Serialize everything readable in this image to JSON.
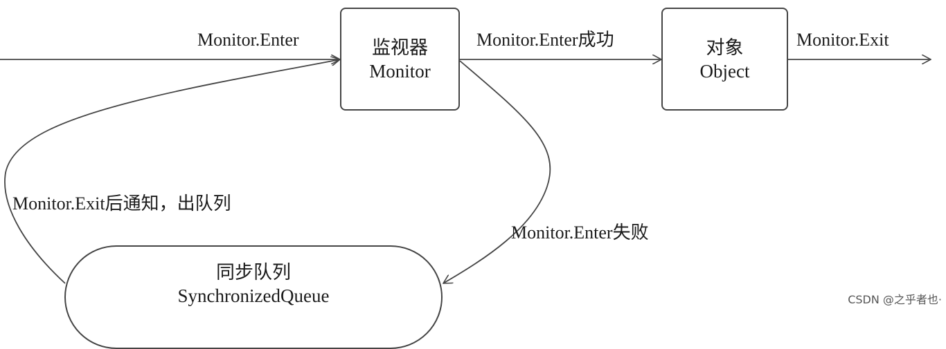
{
  "nodes": {
    "monitor": {
      "line1": "监视器",
      "line2": "Monitor"
    },
    "object": {
      "line1": "对象",
      "line2": "Object"
    },
    "queue": {
      "line1": "同步队列",
      "line2": "SynchronizedQueue"
    }
  },
  "edges": {
    "enter": "Monitor.Enter",
    "enter_success": "Monitor.Enter成功",
    "exit": "Monitor.Exit",
    "exit_notify": "Monitor.Exit后通知，出队列",
    "enter_fail": "Monitor.Enter失败"
  },
  "watermark": "CSDN @之乎者也·"
}
